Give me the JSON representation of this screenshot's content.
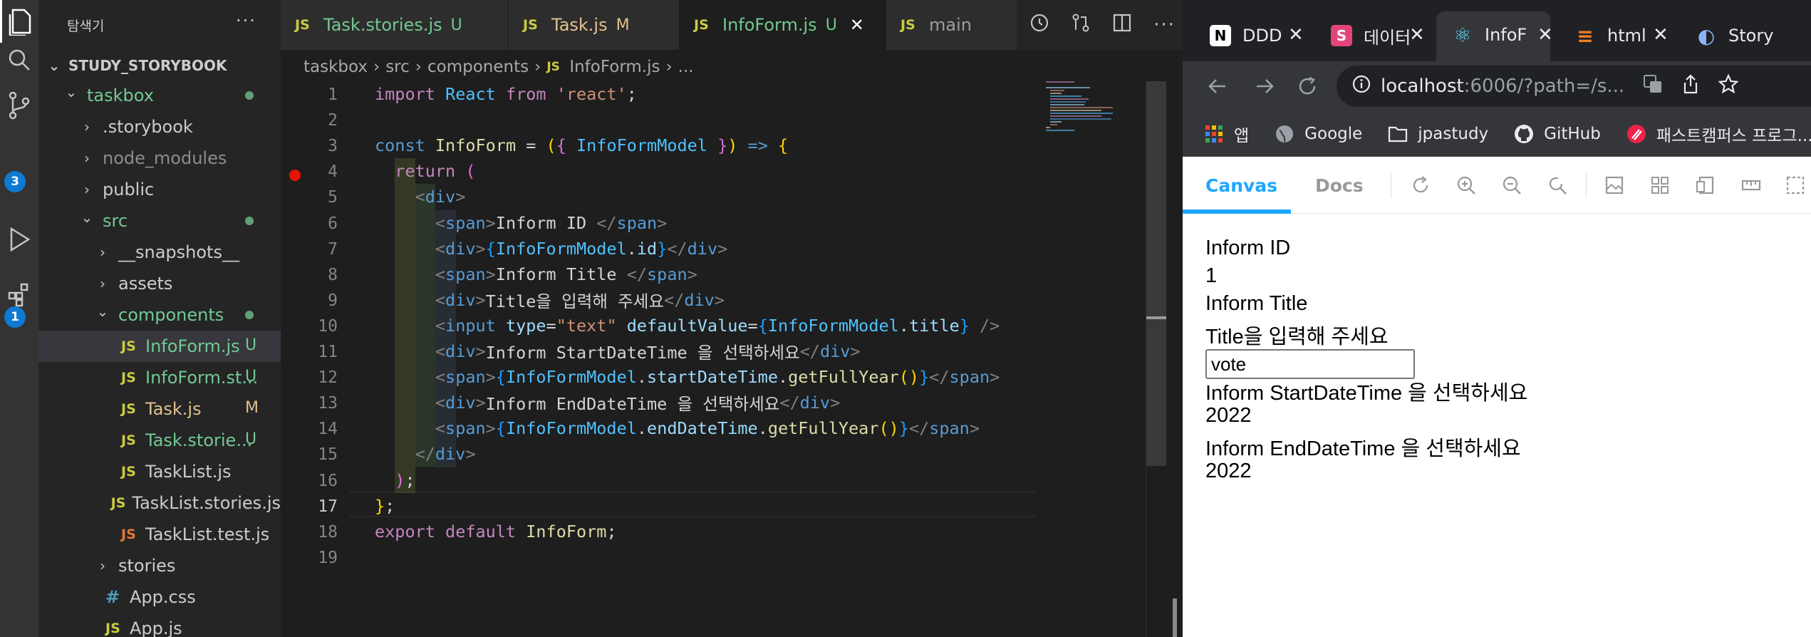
{
  "explorer": {
    "title": "탐색기",
    "more": "···",
    "project": "STUDY_STORYBOOK",
    "items": [
      {
        "label": "taskbox",
        "type": "folder-open",
        "indent": 1,
        "color": "green",
        "dot": true
      },
      {
        "label": ".storybook",
        "type": "folder",
        "indent": 2
      },
      {
        "label": "node_modules",
        "type": "folder",
        "indent": 2,
        "muted": true
      },
      {
        "label": "public",
        "type": "folder",
        "indent": 2
      },
      {
        "label": "src",
        "type": "folder-open",
        "indent": 2,
        "color": "green",
        "dot": true
      },
      {
        "label": "__snapshots__",
        "type": "folder",
        "indent": 3
      },
      {
        "label": "assets",
        "type": "folder",
        "indent": 3
      },
      {
        "label": "components",
        "type": "folder-open",
        "indent": 3,
        "color": "green",
        "dot": true
      },
      {
        "label": "InfoForm.js",
        "type": "js",
        "indent": 4,
        "color": "green",
        "status": "U",
        "selected": true
      },
      {
        "label": "InfoForm.st...",
        "type": "js",
        "indent": 4,
        "color": "green",
        "status": "U"
      },
      {
        "label": "Task.js",
        "type": "js",
        "indent": 4,
        "color": "yellow",
        "status": "M"
      },
      {
        "label": "Task.storie...",
        "type": "js",
        "indent": 4,
        "color": "green",
        "status": "U"
      },
      {
        "label": "TaskList.js",
        "type": "js",
        "indent": 4
      },
      {
        "label": "TaskList.stories.js",
        "type": "js",
        "indent": 4
      },
      {
        "label": "TaskList.test.js",
        "type": "jsorange",
        "indent": 4
      },
      {
        "label": "stories",
        "type": "folder",
        "indent": 3
      },
      {
        "label": "App.css",
        "type": "css",
        "indent": 3
      },
      {
        "label": "App.js",
        "type": "js",
        "indent": 3
      }
    ]
  },
  "activity": {
    "badges": [
      "3",
      "1"
    ]
  },
  "editor_tabs": [
    {
      "label": "Task.stories.js",
      "status": "U",
      "color": "green"
    },
    {
      "label": "Task.js",
      "status": "M",
      "color": "yellow"
    },
    {
      "label": "InfoForm.js",
      "status": "U",
      "color": "green",
      "active": true
    },
    {
      "label": "main",
      "status": "",
      "color": "muted"
    }
  ],
  "js_badge": "JS",
  "close_glyph": "✕",
  "breadcrumb": [
    "taskbox",
    "src",
    "components",
    "InfoForm.js",
    "..."
  ],
  "line_numbers": [
    "1",
    "2",
    "3",
    "4",
    "5",
    "6",
    "7",
    "8",
    "9",
    "10",
    "11",
    "12",
    "13",
    "14",
    "15",
    "16",
    "17",
    "18",
    "19"
  ],
  "code": [
    [
      [
        "kw",
        "import"
      ],
      [
        "txt",
        " "
      ],
      [
        "var",
        "React"
      ],
      [
        "txt",
        " "
      ],
      [
        "kw",
        "from"
      ],
      [
        "txt",
        " "
      ],
      [
        "str",
        "'react'"
      ],
      [
        "txt",
        ";"
      ]
    ],
    [],
    [
      [
        "kw2",
        "const"
      ],
      [
        "txt",
        " "
      ],
      [
        "fn",
        "InfoForm"
      ],
      [
        "txt",
        " = "
      ],
      [
        "br1",
        "("
      ],
      [
        "br2",
        "{"
      ],
      [
        "txt",
        " "
      ],
      [
        "var",
        "InfoFormModel"
      ],
      [
        "txt",
        " "
      ],
      [
        "br2",
        "}"
      ],
      [
        "br1",
        ")"
      ],
      [
        "txt",
        " "
      ],
      [
        "kw2",
        "=>"
      ],
      [
        "txt",
        " "
      ],
      [
        "br1",
        "{"
      ]
    ],
    [
      [
        "txt",
        "  "
      ],
      [
        "kw",
        "return"
      ],
      [
        "txt",
        " "
      ],
      [
        "br2",
        "("
      ]
    ],
    [
      [
        "txt",
        "    "
      ],
      [
        "punc",
        "<"
      ],
      [
        "tag",
        "div"
      ],
      [
        "punc",
        ">"
      ]
    ],
    [
      [
        "txt",
        "      "
      ],
      [
        "punc",
        "<"
      ],
      [
        "tag",
        "span"
      ],
      [
        "punc",
        ">"
      ],
      [
        "txt",
        "Inform ID "
      ],
      [
        "punc",
        "</"
      ],
      [
        "tag",
        "span"
      ],
      [
        "punc",
        ">"
      ]
    ],
    [
      [
        "txt",
        "      "
      ],
      [
        "punc",
        "<"
      ],
      [
        "tag",
        "div"
      ],
      [
        "punc",
        ">"
      ],
      [
        "br3",
        "{"
      ],
      [
        "var",
        "InfoFormModel"
      ],
      [
        "txt",
        "."
      ],
      [
        "prop",
        "id"
      ],
      [
        "br3",
        "}"
      ],
      [
        "punc",
        "</"
      ],
      [
        "tag",
        "div"
      ],
      [
        "punc",
        ">"
      ]
    ],
    [
      [
        "txt",
        "      "
      ],
      [
        "punc",
        "<"
      ],
      [
        "tag",
        "span"
      ],
      [
        "punc",
        ">"
      ],
      [
        "txt",
        "Inform Title "
      ],
      [
        "punc",
        "</"
      ],
      [
        "tag",
        "span"
      ],
      [
        "punc",
        ">"
      ]
    ],
    [
      [
        "txt",
        "      "
      ],
      [
        "punc",
        "<"
      ],
      [
        "tag",
        "div"
      ],
      [
        "punc",
        ">"
      ],
      [
        "txt",
        "Title을 입력해 주세요"
      ],
      [
        "punc",
        "</"
      ],
      [
        "tag",
        "div"
      ],
      [
        "punc",
        ">"
      ]
    ],
    [
      [
        "txt",
        "      "
      ],
      [
        "punc",
        "<"
      ],
      [
        "tag",
        "input"
      ],
      [
        "txt",
        " "
      ],
      [
        "prop",
        "type"
      ],
      [
        "txt",
        "="
      ],
      [
        "str",
        "\"text\""
      ],
      [
        "txt",
        " "
      ],
      [
        "prop",
        "defaultValue"
      ],
      [
        "txt",
        "="
      ],
      [
        "br3",
        "{"
      ],
      [
        "var",
        "InfoFormModel"
      ],
      [
        "txt",
        "."
      ],
      [
        "prop",
        "title"
      ],
      [
        "br3",
        "}"
      ],
      [
        "txt",
        " "
      ],
      [
        "punc",
        "/>"
      ]
    ],
    [
      [
        "txt",
        "      "
      ],
      [
        "punc",
        "<"
      ],
      [
        "tag",
        "div"
      ],
      [
        "punc",
        ">"
      ],
      [
        "txt",
        "Inform StartDateTime 을 선택하세요"
      ],
      [
        "punc",
        "</"
      ],
      [
        "tag",
        "div"
      ],
      [
        "punc",
        ">"
      ]
    ],
    [
      [
        "txt",
        "      "
      ],
      [
        "punc",
        "<"
      ],
      [
        "tag",
        "span"
      ],
      [
        "punc",
        ">"
      ],
      [
        "br3",
        "{"
      ],
      [
        "var",
        "InfoFormModel"
      ],
      [
        "txt",
        "."
      ],
      [
        "prop",
        "startDateTime"
      ],
      [
        "txt",
        "."
      ],
      [
        "fn",
        "getFullYear"
      ],
      [
        "br1",
        "()"
      ],
      [
        "br3",
        "}"
      ],
      [
        "punc",
        "</"
      ],
      [
        "tag",
        "span"
      ],
      [
        "punc",
        ">"
      ]
    ],
    [
      [
        "txt",
        "      "
      ],
      [
        "punc",
        "<"
      ],
      [
        "tag",
        "div"
      ],
      [
        "punc",
        ">"
      ],
      [
        "txt",
        "Inform EndDateTime 을 선택하세요"
      ],
      [
        "punc",
        "</"
      ],
      [
        "tag",
        "div"
      ],
      [
        "punc",
        ">"
      ]
    ],
    [
      [
        "txt",
        "      "
      ],
      [
        "punc",
        "<"
      ],
      [
        "tag",
        "span"
      ],
      [
        "punc",
        ">"
      ],
      [
        "br3",
        "{"
      ],
      [
        "var",
        "InfoFormModel"
      ],
      [
        "txt",
        "."
      ],
      [
        "prop",
        "endDateTime"
      ],
      [
        "txt",
        "."
      ],
      [
        "fn",
        "getFullYear"
      ],
      [
        "br1",
        "()"
      ],
      [
        "br3",
        "}"
      ],
      [
        "punc",
        "</"
      ],
      [
        "tag",
        "span"
      ],
      [
        "punc",
        ">"
      ]
    ],
    [
      [
        "txt",
        "    "
      ],
      [
        "punc",
        "</"
      ],
      [
        "tag",
        "div"
      ],
      [
        "punc",
        ">"
      ]
    ],
    [
      [
        "txt",
        "  "
      ],
      [
        "br2",
        ")"
      ],
      [
        "txt",
        ";"
      ]
    ],
    [
      [
        "br1",
        "}"
      ],
      [
        "txt",
        ";"
      ]
    ],
    [
      [
        "kw",
        "export"
      ],
      [
        "txt",
        " "
      ],
      [
        "kw",
        "default"
      ],
      [
        "txt",
        " "
      ],
      [
        "fn",
        "InfoForm"
      ],
      [
        "txt",
        ";"
      ]
    ],
    []
  ],
  "browser": {
    "tabs": [
      {
        "label": "DDD",
        "fav": "N",
        "fav_bg": "#ffffff",
        "fav_fg": "#000000"
      },
      {
        "label": "데이터",
        "fav": "S",
        "fav_bg": "#e4447a",
        "fav_fg": "#ffffff"
      },
      {
        "label": "InfoF",
        "fav": "⚛",
        "fav_bg": "transparent",
        "fav_fg": "#61dafb",
        "active": true
      },
      {
        "label": "html",
        "fav": "≡",
        "fav_bg": "transparent",
        "fav_fg": "#f48024"
      },
      {
        "label": "Story",
        "fav": "◐",
        "fav_bg": "transparent",
        "fav_fg": "#8ab4f8"
      }
    ],
    "url_host": "localhost",
    "url_path": ":6006/?path=/s...",
    "bookmarks": [
      "앱",
      "Google",
      "jpastudy",
      "GitHub",
      "패스트캠퍼스 프로그..."
    ]
  },
  "storybook": {
    "tab_canvas": "Canvas",
    "tab_docs": "Docs",
    "accent": "#1ea7fd"
  },
  "preview": {
    "id_label": "Inform ID",
    "id_value": "1",
    "title_label": "Inform Title",
    "title_hint": "Title을 입력해 주세요",
    "title_input_value": "vote",
    "start_label": "Inform StartDateTime 을 선택하세요",
    "start_value": "2022",
    "end_label": "Inform EndDateTime 을 선택하세요",
    "end_value": "2022"
  }
}
